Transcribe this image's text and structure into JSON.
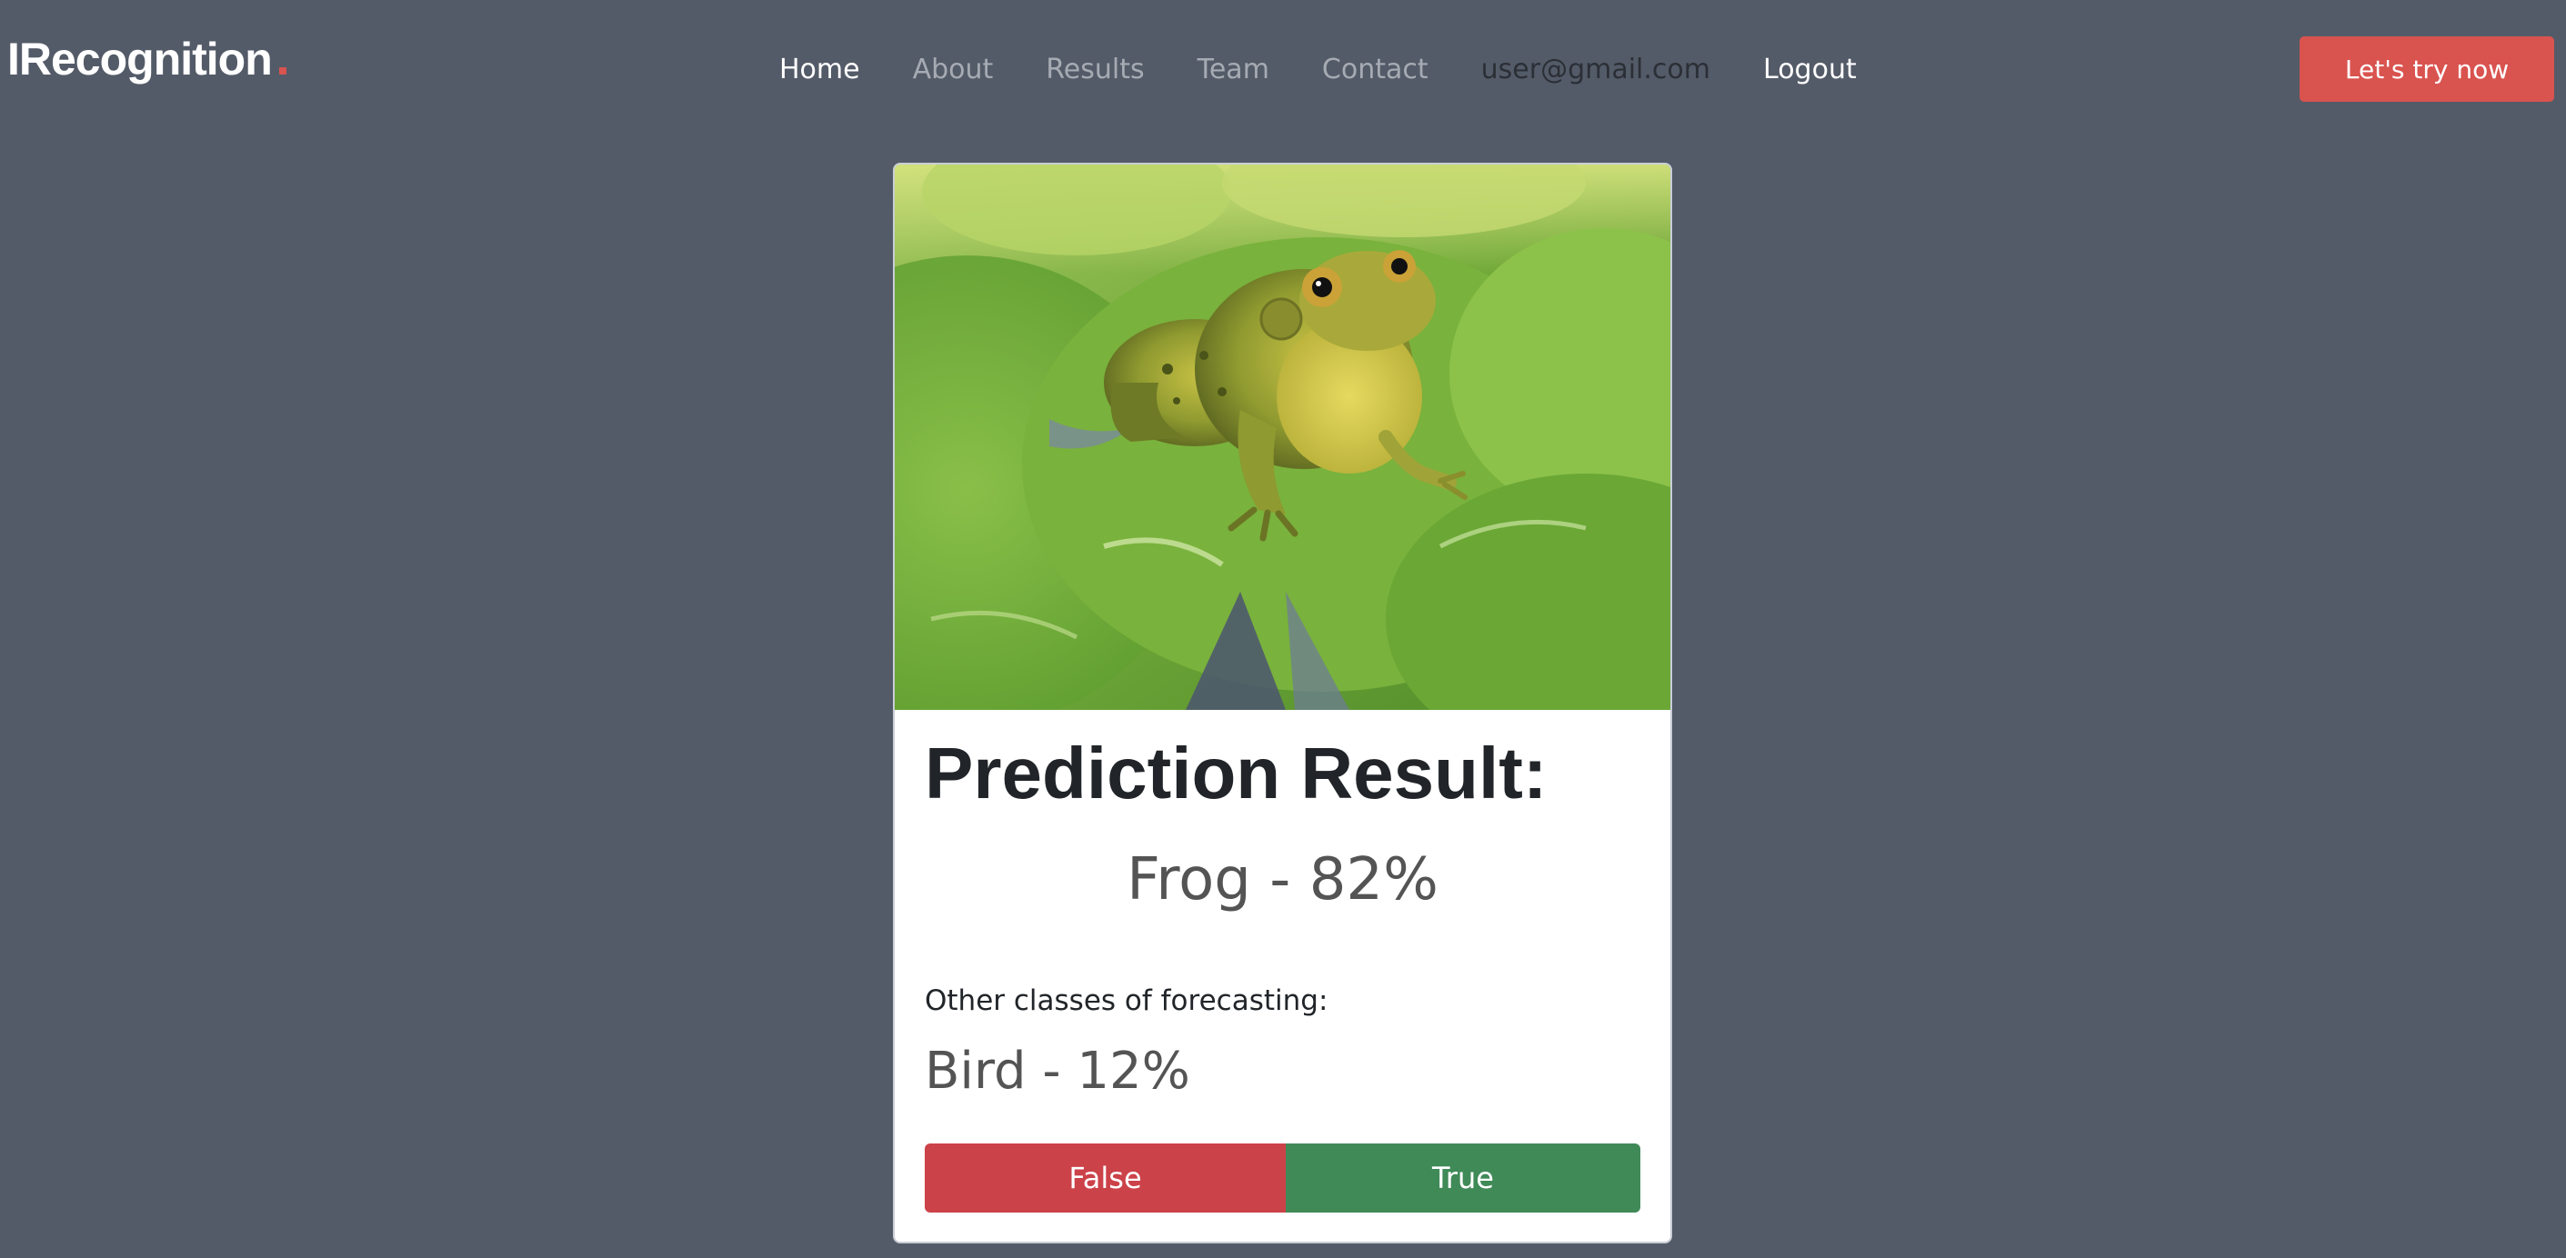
{
  "brand": {
    "name": "IRecognition",
    "accent": "#d9534f"
  },
  "nav": {
    "items": [
      {
        "label": "Home"
      },
      {
        "label": "About"
      },
      {
        "label": "Results"
      },
      {
        "label": "Team"
      },
      {
        "label": "Contact"
      }
    ],
    "user_email": "user@gmail.com",
    "logout_label": "Logout"
  },
  "cta": {
    "label": "Let's try now"
  },
  "result": {
    "image_alt_icon": "frog-photo",
    "title": "Prediction Result:",
    "main_prediction": "Frog - 82%",
    "other_label": "Other classes of forecasting:",
    "other_prediction": "Bird - 12%",
    "false_label": "False",
    "true_label": "True"
  },
  "colors": {
    "background": "#545b68",
    "false_button": "#cc4249",
    "true_button": "#408a58"
  }
}
